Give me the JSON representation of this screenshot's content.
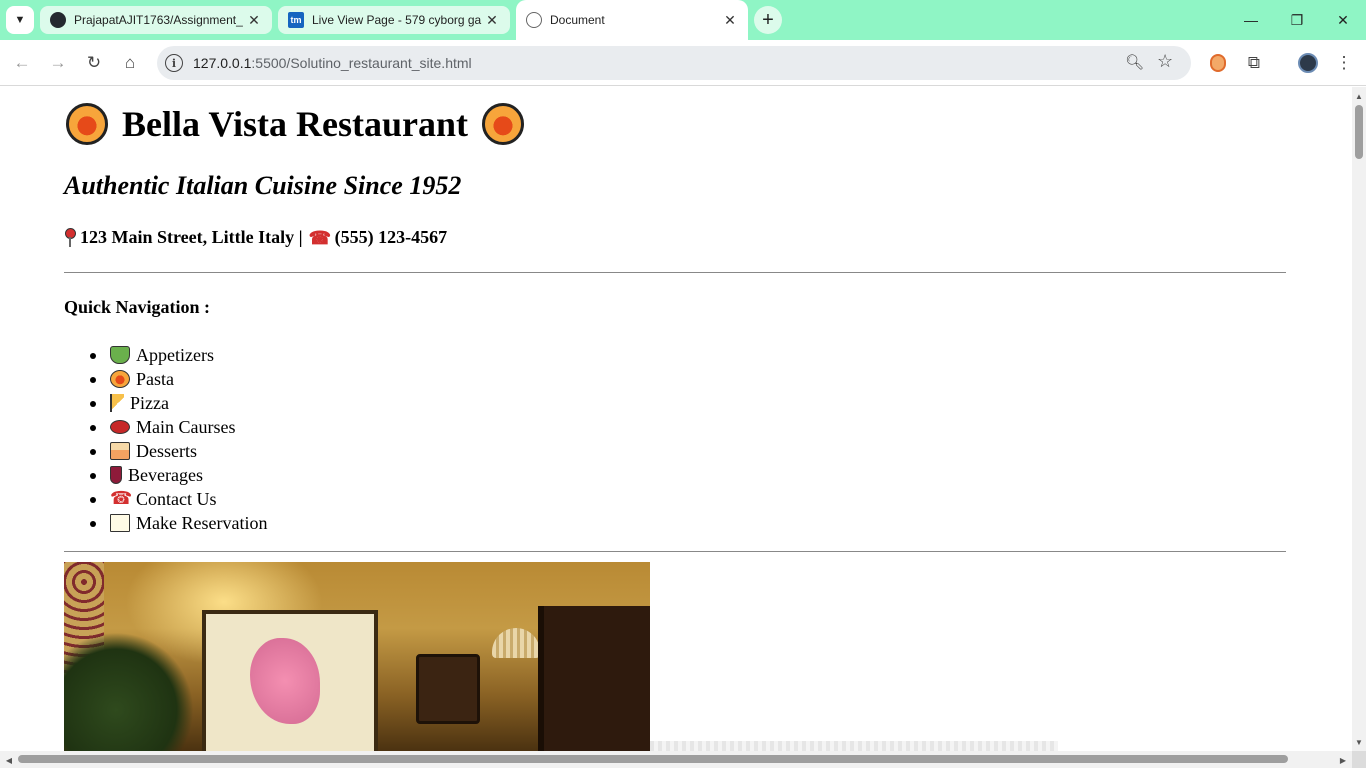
{
  "browser": {
    "tabs": [
      {
        "title": "PrajapatAJIT1763/Assignment_",
        "icon": "github-icon",
        "active": false
      },
      {
        "title": "Live View Page - 579 cyborg ga",
        "icon": "tm-icon",
        "icon_text": "tm",
        "active": false
      },
      {
        "title": "Document",
        "icon": "globe-icon",
        "active": true
      }
    ],
    "close_glyph": "✕",
    "new_tab_glyph": "+",
    "url_host": "127.0.0.1",
    "url_rest": ":5500/Solutino_restaurant_site.html",
    "colors": {
      "tabstrip": "#8ff5c5",
      "omnibox": "#e9ecef"
    }
  },
  "page": {
    "title": "Bella Vista Restaurant",
    "tagline": "Authentic Italian Cuisine Since 1952",
    "address": "123 Main Street, Little Italy |",
    "phone": "(555) 123-4567",
    "quick_nav_heading": "Quick Navigation :",
    "nav_items": [
      {
        "label": "Appetizers",
        "icon": "salad-icon"
      },
      {
        "label": "Pasta",
        "icon": "spaghetti-icon"
      },
      {
        "label": "Pizza",
        "icon": "pizza-icon"
      },
      {
        "label": "Main Caurses",
        "icon": "meat-icon"
      },
      {
        "label": "Desserts",
        "icon": "cake-icon"
      },
      {
        "label": "Beverages",
        "icon": "wine-glass-icon"
      },
      {
        "label": "Contact Us",
        "icon": "telephone-icon"
      },
      {
        "label": "Make Reservation",
        "icon": "memo-icon"
      }
    ],
    "image_subject": "restaurant-interior-photo"
  }
}
